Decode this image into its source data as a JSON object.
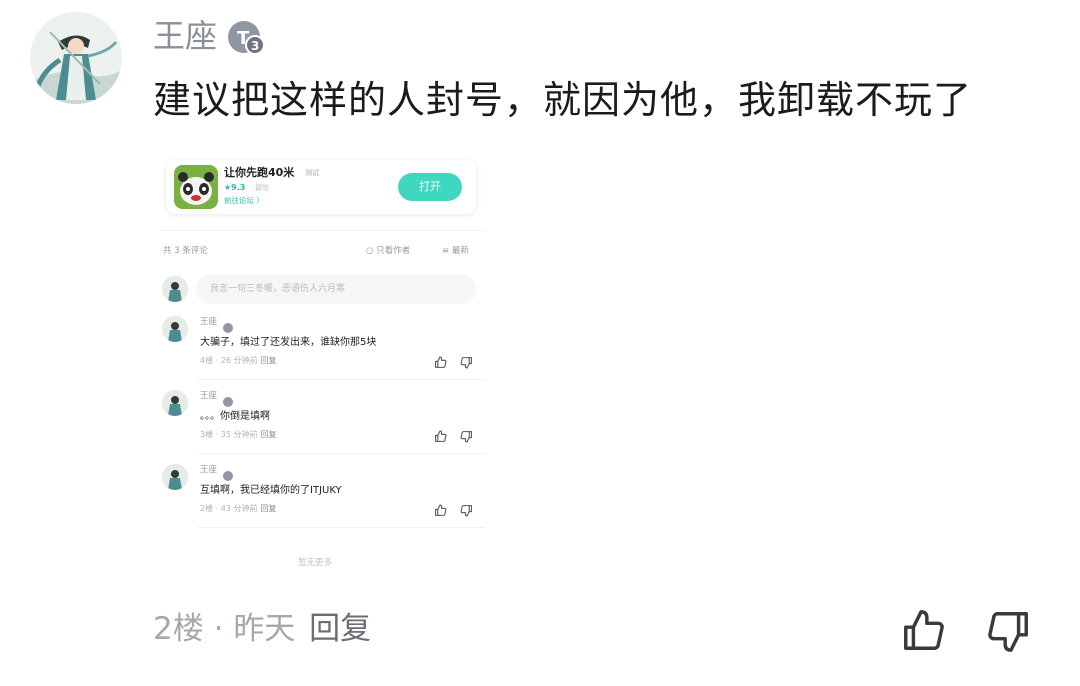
{
  "comment": {
    "username": "王座",
    "badge_level": "3",
    "text": "建议把这样的人封号，就因为他，我卸载不玩了",
    "floor": "2楼",
    "separator": "·",
    "time": "昨天",
    "reply_label": "回复"
  },
  "screenshot": {
    "game": {
      "title": "让你先跑40米",
      "tag": "测试",
      "rating": "★9.3",
      "genre": "冒险",
      "forum_link": "前往论坛 〉",
      "open_label": "打开"
    },
    "comment_count": "共 3 条评论",
    "author_only": "○ 只看作者",
    "sort": "≡ 最新",
    "input_placeholder": "良言一句三冬暖，恶语伤人六月寒",
    "comments": [
      {
        "name": "王座",
        "text": "大骗子，填过了还发出来，谁缺你那5块",
        "floor": "4楼",
        "time": "26 分钟前",
        "reply": "回复"
      },
      {
        "name": "王座",
        "text": "。。。你倒是填啊",
        "floor": "3楼",
        "time": "35 分钟前",
        "reply": "回复"
      },
      {
        "name": "王座",
        "text": "互填啊，我已经填你的了ITJUKY",
        "floor": "2楼",
        "time": "43 分钟前",
        "reply": "回复"
      }
    ],
    "no_more": "暂无更多"
  },
  "colors": {
    "accent": "#3fd7c0",
    "rating_green": "#23c0a3",
    "muted_text": "#a5a8ad"
  },
  "icons": [
    "avatar",
    "level-badge-icon",
    "thumbs-up-icon",
    "thumbs-down-icon",
    "game-app-icon"
  ]
}
